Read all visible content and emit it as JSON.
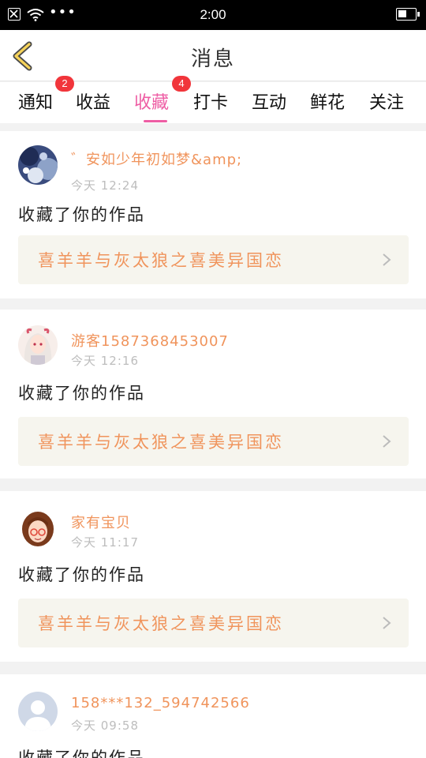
{
  "status": {
    "time": "2:00",
    "dots": "•••"
  },
  "header": {
    "title": "消息"
  },
  "tabs": [
    {
      "label": "通知",
      "badge": "2"
    },
    {
      "label": "收益",
      "badge": ""
    },
    {
      "label": "收藏",
      "badge": "4",
      "active": true
    },
    {
      "label": "打卡",
      "badge": ""
    },
    {
      "label": "互动",
      "badge": ""
    },
    {
      "label": "鲜花",
      "badge": ""
    },
    {
      "label": "关注",
      "badge": ""
    }
  ],
  "notifications": [
    {
      "user": "゛安如少年初如梦&amp;",
      "time": "今天 12:24",
      "action": "收藏了你的作品",
      "work": "喜羊羊与灰太狼之喜美异国恋"
    },
    {
      "user": "游客1587368453007",
      "time": "今天 12:16",
      "action": "收藏了你的作品",
      "work": "喜羊羊与灰太狼之喜美异国恋"
    },
    {
      "user": "家有宝贝",
      "time": "今天 11:17",
      "action": "收藏了你的作品",
      "work": "喜羊羊与灰太狼之喜美异国恋"
    },
    {
      "user": "158***132_594742566",
      "time": "今天 09:58",
      "action": "收藏了你的作品",
      "work": ""
    }
  ],
  "colors": {
    "accent": "#ee5da4",
    "orange": "#f0945c",
    "badge": "#f1353b",
    "card_bg": "#f6f5ee"
  }
}
